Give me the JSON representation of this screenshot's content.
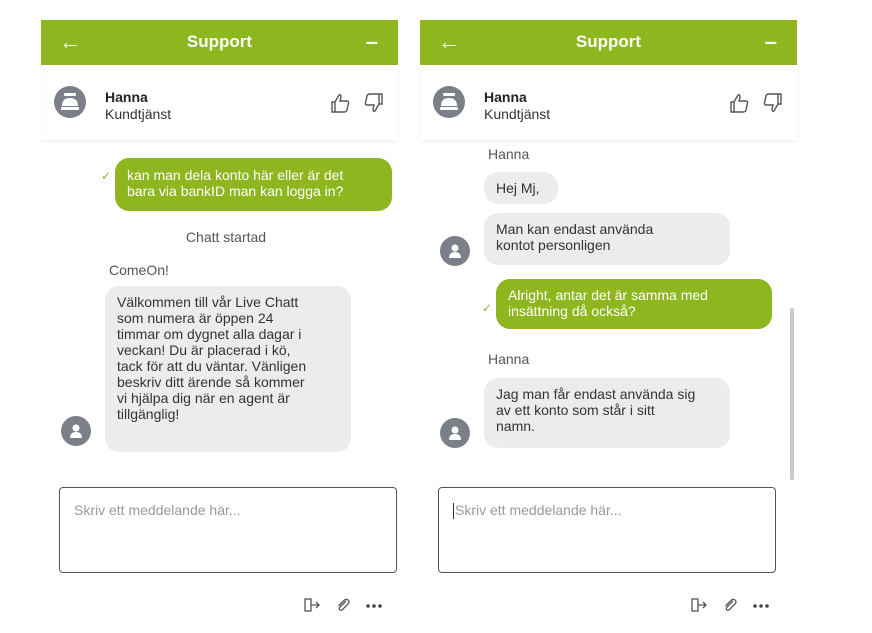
{
  "left": {
    "header": {
      "back_icon": "arrow-left-icon",
      "title": "Support",
      "minimize_icon": "minus-icon"
    },
    "agent": {
      "name": "Hanna",
      "role": "Kundtjänst"
    },
    "messages": {
      "outgoing_1": [
        "kan man dela konto här eller är det",
        "bara via bankID man kan logga in?"
      ],
      "system": "Chatt startad",
      "sender": "ComeOn!",
      "incoming_1": [
        "Välkommen till vår Live Chatt",
        "som numera är öppen 24",
        "timmar om dygnet alla dagar i",
        "veckan! Du är placerad i kö,",
        "tack för att du väntar. Vänligen",
        "beskriv ditt ärende så kommer",
        "vi hjälpa dig när en agent är",
        "tillgänglig!"
      ]
    },
    "input": {
      "placeholder": "Skriv ett meddelande här..."
    }
  },
  "right": {
    "header": {
      "back_icon": "arrow-left-icon",
      "title": "Support",
      "minimize_icon": "minus-icon"
    },
    "agent": {
      "name": "Hanna",
      "role": "Kundtjänst"
    },
    "messages": {
      "sender_1": "Hanna",
      "incoming_1": [
        "Hej Mj,"
      ],
      "incoming_2": [
        "Man kan endast använda",
        "kontot personligen"
      ],
      "outgoing_1": [
        "Alright, antar det är samma med",
        "insättning då också?"
      ],
      "sender_2": "Hanna",
      "incoming_3": [
        "Jag man får endast använda sig",
        "av ett konto som står i sitt",
        "namn."
      ]
    },
    "input": {
      "placeholder": "Skriv ett meddelande här..."
    }
  },
  "colors": {
    "brand_green": "#8db61f",
    "bubble_gray": "#ececee",
    "avatar_gray": "#7b8088"
  },
  "footer_icons": [
    "exit-icon",
    "paperclip-icon",
    "more-dots-icon"
  ]
}
